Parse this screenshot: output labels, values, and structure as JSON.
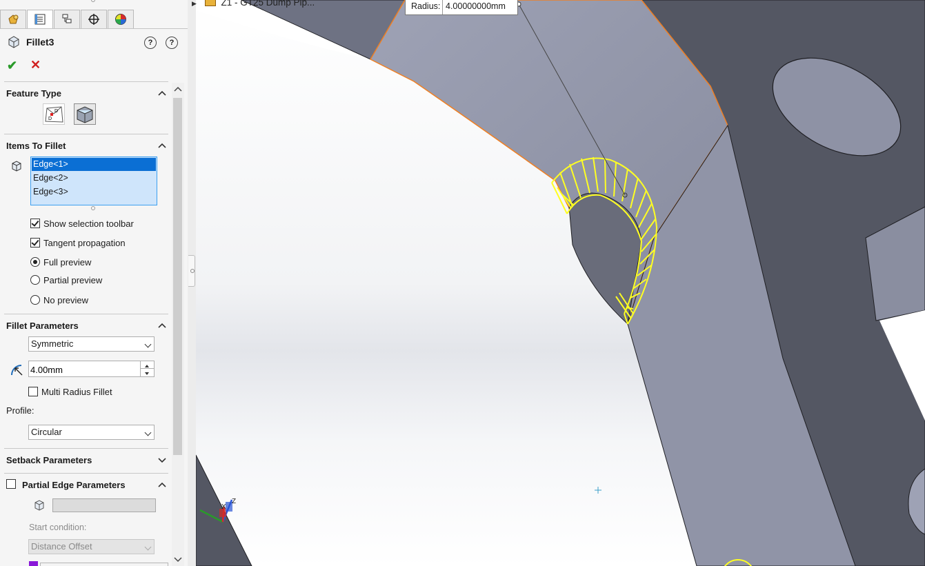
{
  "property_manager": {
    "tabs": [
      "feature-manager-tab",
      "property-manager-tab",
      "configuration-manager-tab",
      "dimxpert-manager-tab",
      "display-manager-tab"
    ],
    "title": "Fillet3",
    "help1": "?",
    "help2": "?",
    "ok_symbol": "✔",
    "cancel_symbol": "✕"
  },
  "feature_type": {
    "heading": "Feature Type"
  },
  "items_to_fillet": {
    "heading": "Items To Fillet",
    "items": [
      "Edge<1>",
      "Edge<2>",
      "Edge<3>"
    ],
    "show_selection_toolbar": "Show selection toolbar",
    "tangent_propagation": "Tangent propagation",
    "full_preview": "Full preview",
    "partial_preview": "Partial preview",
    "no_preview": "No preview",
    "selected_preview": "Full preview"
  },
  "fillet_parameters": {
    "heading": "Fillet Parameters",
    "method": "Symmetric",
    "radius": "4.00mm",
    "multi_radius": "Multi Radius Fillet",
    "profile_label": "Profile:",
    "profile": "Circular"
  },
  "setback": {
    "heading": "Setback Parameters"
  },
  "partial_edge": {
    "heading": "Partial Edge Parameters",
    "start_condition_label": "Start condition:",
    "start_condition": "Distance Offset"
  },
  "viewport": {
    "tree_item": "Z1 - GT25 Dump Pip...",
    "radius_label": "Radius:",
    "radius_value": "4.00000000mm",
    "axis_x": "X",
    "axis_z": "Z",
    "colors": {
      "body": "#8e92a5",
      "body_dark": "#545763",
      "preview": "#ffff22",
      "highlight": "#f07f22"
    }
  }
}
